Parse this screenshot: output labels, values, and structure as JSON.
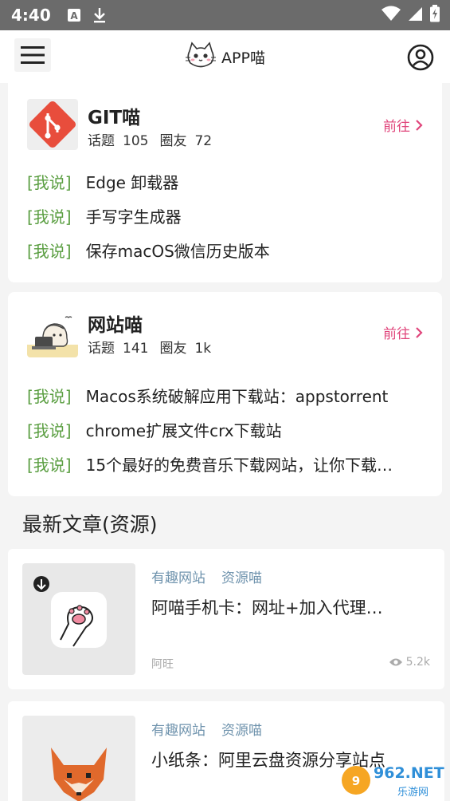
{
  "status_bar": {
    "time": "4:40"
  },
  "header": {
    "title": "APP喵"
  },
  "topics": [
    {
      "title": "GIT喵",
      "topic_label": "话题",
      "topic_count": "105",
      "friend_label": "圈友",
      "friend_count": "72",
      "goto_label": "前往",
      "posts": [
        {
          "tag": "[我说]",
          "text": "Edge 卸载器"
        },
        {
          "tag": "[我说]",
          "text": "手写字生成器"
        },
        {
          "tag": "[我说]",
          "text": "保存macOS微信历史版本"
        }
      ]
    },
    {
      "title": "网站喵",
      "topic_label": "话题",
      "topic_count": "141",
      "friend_label": "圈友",
      "friend_count": "1k",
      "goto_label": "前往",
      "posts": [
        {
          "tag": "[我说]",
          "text": "Macos系统破解应用下载站：appstorrent"
        },
        {
          "tag": "[我说]",
          "text": "chrome扩展文件crx下载站"
        },
        {
          "tag": "[我说]",
          "text": "15个最好的免费音乐下载网站，让你下载…"
        }
      ]
    }
  ],
  "latest": {
    "section_title": "最新文章(资源)",
    "articles": [
      {
        "cats": [
          "有趣网站",
          "资源喵"
        ],
        "title": "阿喵手机卡：网址+加入代理…",
        "author": "阿旺",
        "views": "5.2k"
      },
      {
        "cats": [
          "有趣网站",
          "资源喵"
        ],
        "title": "小纸条：阿里云盘资源分享站点"
      }
    ]
  },
  "watermark": {
    "text": "962.NET",
    "sub": "乐游网"
  },
  "colors": {
    "accent": "#e0457b",
    "tag_green": "#5a9e41",
    "category_blue": "#6f93ad",
    "git_red": "#e84d3c"
  }
}
